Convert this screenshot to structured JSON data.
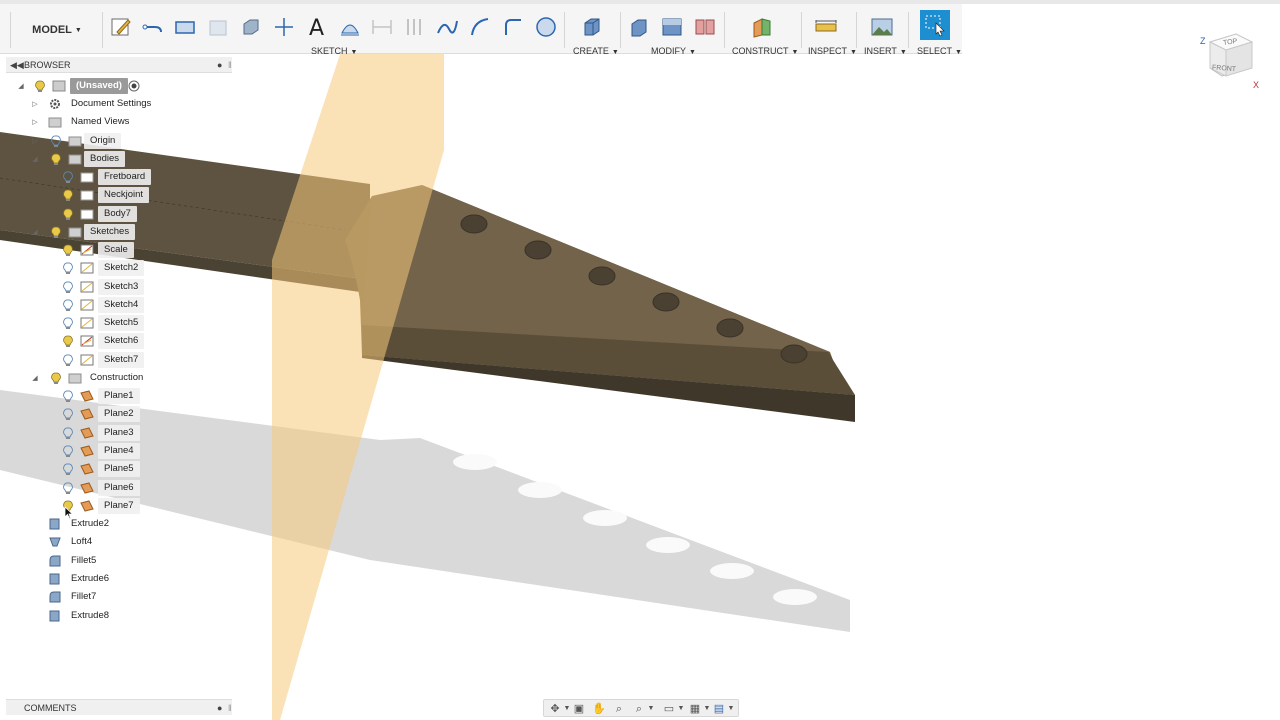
{
  "toolbar": {
    "model_label": "MODEL",
    "groups": {
      "sketch": "SKETCH",
      "create": "CREATE",
      "modify": "MODIFY",
      "construct": "CONSTRUCT",
      "inspect": "INSPECT",
      "insert": "INSERT",
      "select": "SELECT"
    }
  },
  "browser": {
    "title": "BROWSER",
    "root": "(Unsaved)",
    "items": {
      "document_settings": "Document Settings",
      "named_views": "Named Views",
      "origin": "Origin",
      "bodies": "Bodies",
      "fretboard": "Fretboard",
      "neckjoint": "Neckjoint",
      "body7": "Body7",
      "sketches": "Sketches",
      "scale": "Scale",
      "sketch2": "Sketch2",
      "sketch3": "Sketch3",
      "sketch4": "Sketch4",
      "sketch5": "Sketch5",
      "sketch6": "Sketch6",
      "sketch7": "Sketch7",
      "construction": "Construction",
      "plane1": "Plane1",
      "plane2": "Plane2",
      "plane3": "Plane3",
      "plane4": "Plane4",
      "plane5": "Plane5",
      "plane6": "Plane6",
      "plane7": "Plane7",
      "extrude2": "Extrude2",
      "loft4": "Loft4",
      "fillet5": "Fillet5",
      "extrude6": "Extrude6",
      "fillet7": "Fillet7",
      "extrude8": "Extrude8"
    }
  },
  "comments": {
    "title": "COMMENTS"
  },
  "viewcube": {
    "top": "TOP",
    "front": "FRONT",
    "axis_z": "Z",
    "axis_x": "X"
  },
  "colors": {
    "plane_fill": "#f5c97a",
    "body_fill": "#6b5c43",
    "select_accent": "#1d8fd0",
    "bulb_on": "#e9c94a",
    "bulb_off": "#7aa6c9"
  }
}
